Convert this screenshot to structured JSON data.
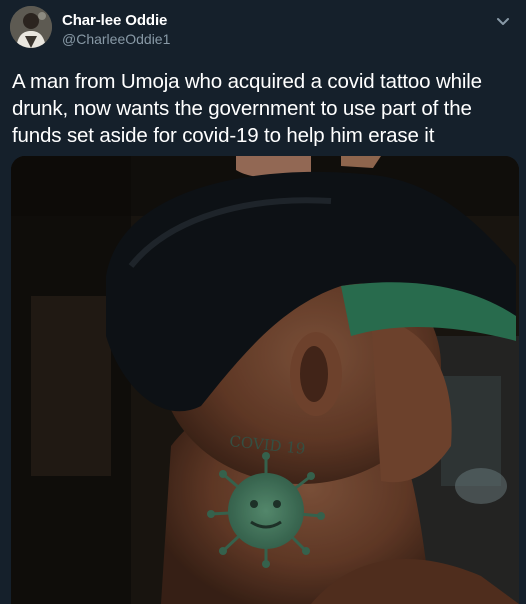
{
  "author": {
    "display_name": "Char-lee Oddie",
    "handle": "@CharleeOddie1",
    "avatar_icon": "profile-avatar"
  },
  "menu": {
    "icon": "chevron-down-icon"
  },
  "tweet": {
    "text": "A man from Umoja who acquired a covid tattoo while drunk, now wants the government to use part of the funds set aside for covid-19 to help him erase it"
  },
  "media": {
    "tattoo_text": "COVID 19"
  },
  "colors": {
    "background": "#15202b",
    "text_primary": "#ffffff",
    "text_secondary": "#8899a6"
  }
}
